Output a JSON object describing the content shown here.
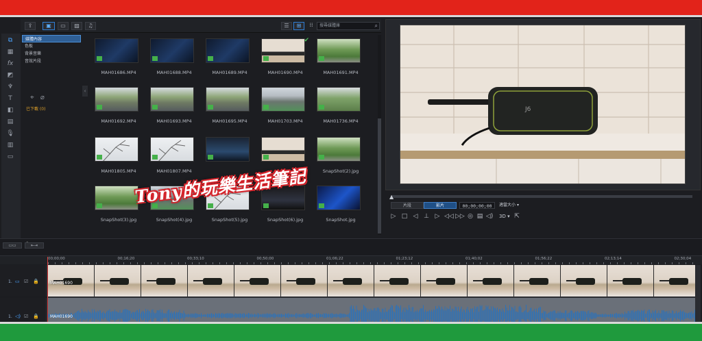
{
  "library": {
    "tree_items": [
      "媒體內容",
      "色板",
      "背景音樂",
      "音效片段"
    ],
    "downloaded_label": "已下載 (0)",
    "search_placeholder": "搜尋媒體庫",
    "clips": [
      {
        "name": "MAH01686.MP4",
        "thumb": "dark-screen"
      },
      {
        "name": "MAH01688.MP4",
        "thumb": "dark-screen"
      },
      {
        "name": "MAH01689.MP4",
        "thumb": "dark-screen"
      },
      {
        "name": "MAH01690.MP4",
        "thumb": "device"
      },
      {
        "name": "MAH01691.MP4",
        "thumb": "trees"
      },
      {
        "name": "MAH01692.MP4",
        "thumb": "road"
      },
      {
        "name": "MAH01693.MP4",
        "thumb": "road"
      },
      {
        "name": "MAH01695.MP4",
        "thumb": "road"
      },
      {
        "name": "MAH01703.MP4",
        "thumb": "highway"
      },
      {
        "name": "MAH01736.MP4",
        "thumb": "dog"
      },
      {
        "name": "MAH01805.MP4",
        "thumb": "branches"
      },
      {
        "name": "MAH01807.MP4",
        "thumb": "branches"
      },
      {
        "name": "",
        "thumb": "app-screen"
      },
      {
        "name": "",
        "thumb": "device"
      },
      {
        "name": "SnapShot(2).jpg",
        "thumb": "trees"
      },
      {
        "name": "SnapShot(3).jpg",
        "thumb": "trees"
      },
      {
        "name": "SnapShot(4).jpg",
        "thumb": "highway"
      },
      {
        "name": "SnapShot(5).jpg",
        "thumb": "branches"
      },
      {
        "name": "SnapShot(6).jpg",
        "thumb": "tv-room"
      },
      {
        "name": "SnapShot.jpg",
        "thumb": "car-ad"
      }
    ]
  },
  "preview": {
    "mode_clip": "片段",
    "mode_movie": "影片",
    "timecode": "00;00;00;00",
    "fit_label": "適當大小",
    "label_3d": "3D"
  },
  "timeline": {
    "ruler": [
      "00;00;00",
      "00;16;20",
      "00;33;10",
      "00;50;00",
      "01;06;22",
      "01;23;12",
      "01;40;02",
      "01;56;22",
      "02;13;14",
      "02;30;04"
    ],
    "video_track_label": "1.",
    "audio_track_label": "1.",
    "video_clip_title": "MAH01690",
    "audio_clip_title": "MAH01690"
  },
  "watermark": "Tony的玩樂生活筆記",
  "colors": {
    "top_bar": "#e2231a",
    "bottom_bar": "#1f9a3d",
    "audio_wave": "#2e72b8",
    "selection": "#2f5f95"
  }
}
